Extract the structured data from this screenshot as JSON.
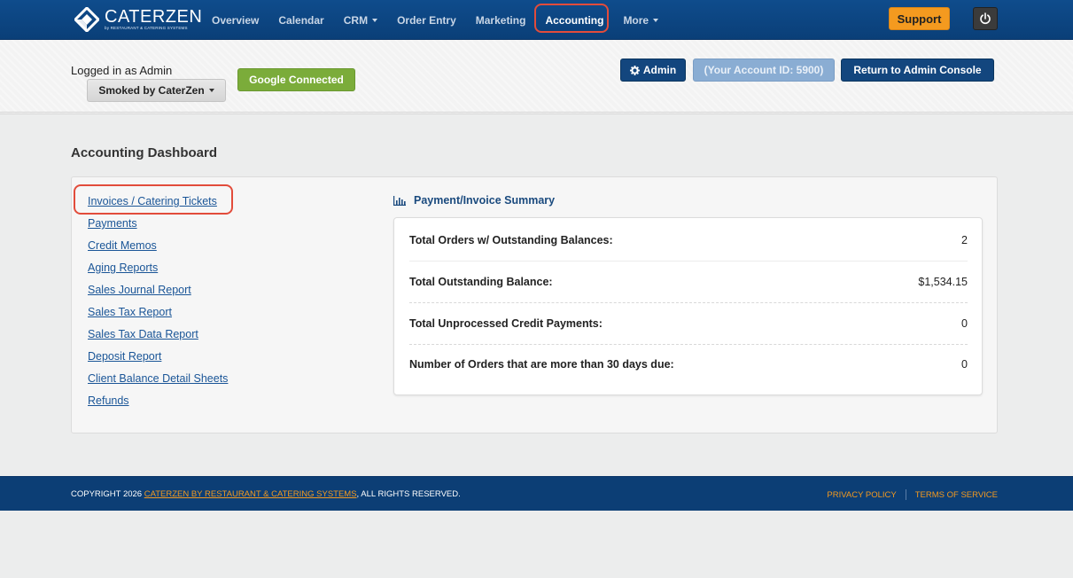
{
  "brand": {
    "name": "CATERZEN",
    "tagline": "by RESTAURANT & CATERING SYSTEMS"
  },
  "nav": {
    "items": [
      {
        "label": "Overview"
      },
      {
        "label": "Calendar"
      },
      {
        "label": "CRM"
      },
      {
        "label": "Order Entry"
      },
      {
        "label": "Marketing"
      },
      {
        "label": "Accounting"
      },
      {
        "label": "More"
      }
    ],
    "support_label": "Support"
  },
  "subheader": {
    "logged_in": "Logged in as Admin",
    "venue": "Smoked by CaterZen",
    "google": "Google Connected",
    "admin": "Admin",
    "account_id": "(Your Account ID: 5900)",
    "return": "Return to Admin Console"
  },
  "page": {
    "title": "Accounting Dashboard",
    "links": [
      "Invoices / Catering Tickets",
      "Payments",
      "Credit Memos",
      "Aging Reports",
      "Sales Journal Report",
      "Sales Tax Report",
      "Sales Tax Data Report",
      "Deposit Report",
      "Client Balance Detail Sheets",
      "Refunds"
    ],
    "summary_title": "Payment/Invoice Summary",
    "summary": [
      {
        "label": "Total Orders w/ Outstanding Balances:",
        "value": "2"
      },
      {
        "label": "Total Outstanding Balance:",
        "value": "$1,534.15"
      },
      {
        "label": "Total Unprocessed Credit Payments:",
        "value": "0"
      },
      {
        "label": "Number of Orders that are more than 30 days due:",
        "value": "0"
      }
    ]
  },
  "footer": {
    "copy_prefix": "COPYRIGHT 2026 ",
    "copy_brand": "CATERZEN BY RESTAURANT & CATERING SYSTEMS",
    "copy_suffix": ", ALL RIGHTS RESERVED.",
    "privacy": "PRIVACY POLICY",
    "terms": "TERMS OF SERVICE"
  },
  "colors": {
    "navbar": "#0f4c8c",
    "accent": "#f49a1f",
    "highlight": "#e24c3b",
    "primary_button": "#13467e",
    "success": "#7bac3a"
  }
}
